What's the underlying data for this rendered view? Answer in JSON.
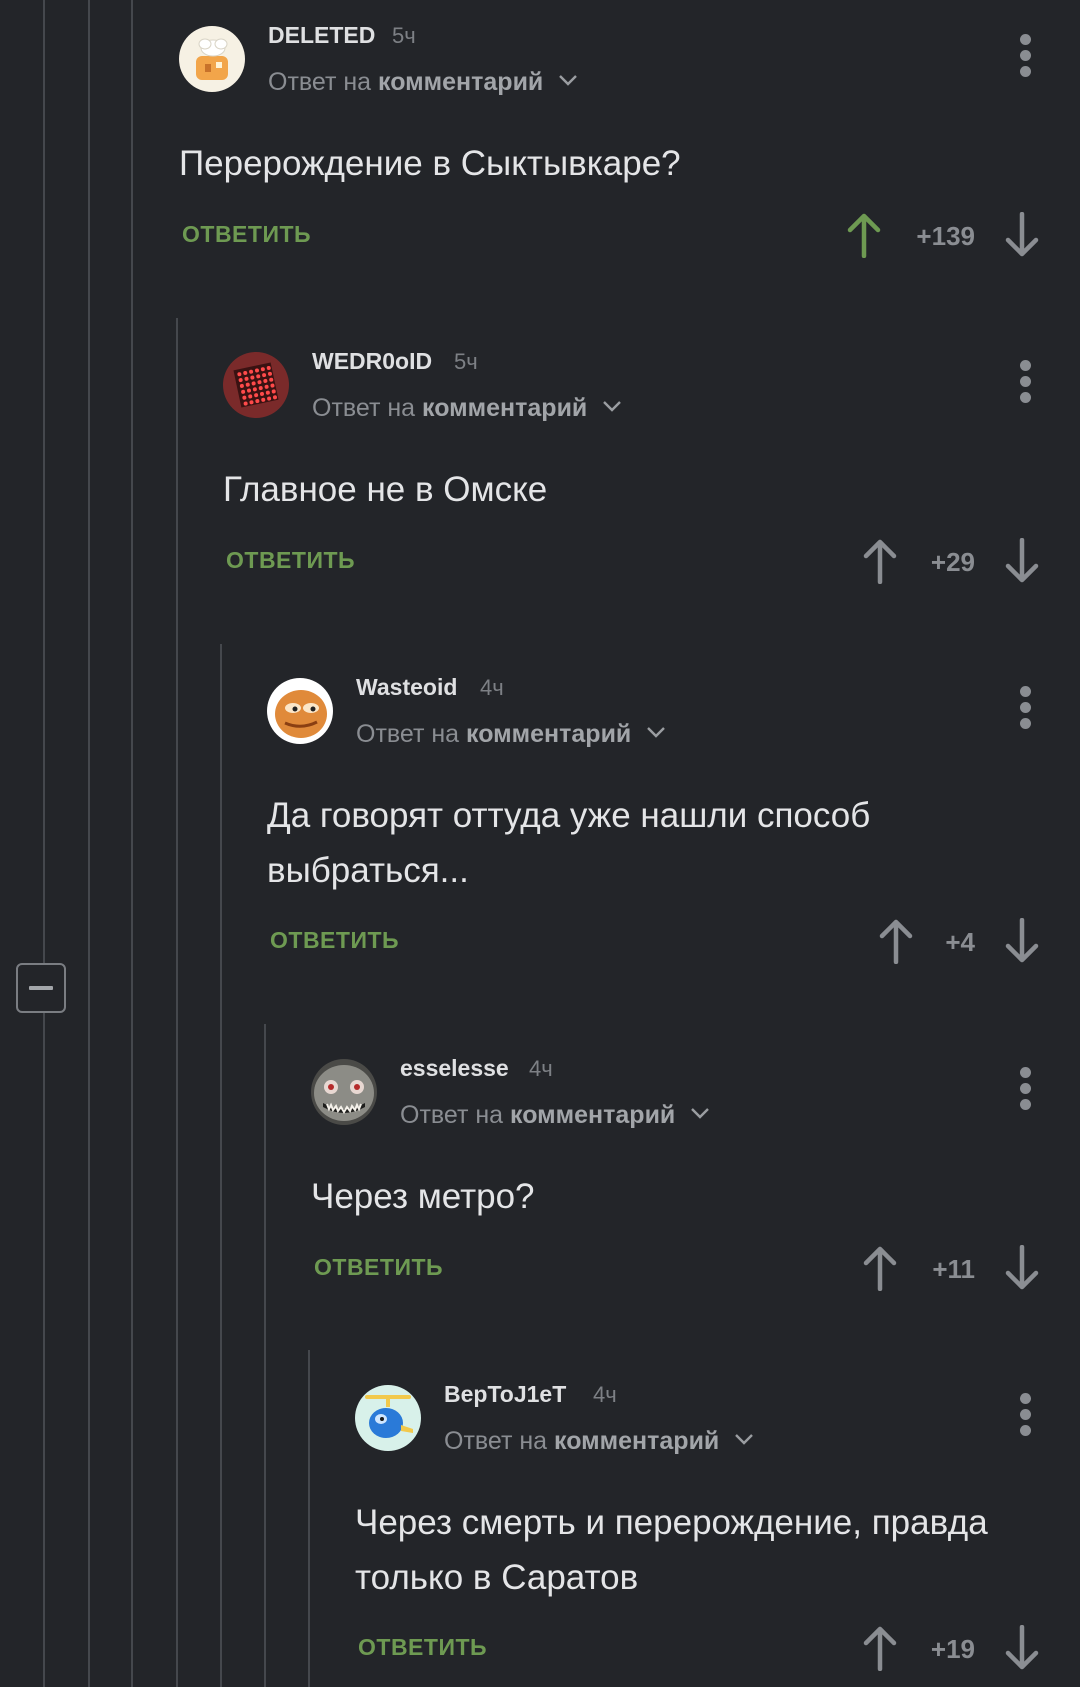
{
  "reply_to_prefix": "Ответ на",
  "reply_to_target": "комментарий",
  "reply_action_label": "ОТВЕТИТЬ",
  "colors": {
    "background": "#232529",
    "reply_green": "#6e9a52",
    "upvoted_arrow": "#6e9a52",
    "muted_gray": "#8a8d92"
  },
  "comments": [
    {
      "username": "DELETED",
      "time": "5ч",
      "text": "Перерождение в Сыктывкаре?",
      "score": "+139",
      "upvoted": true,
      "avatar": "chef-house-avatar"
    },
    {
      "username": "WEDR0oID",
      "time": "5ч",
      "text": "Главное не в Омске",
      "score": "+29",
      "upvoted": false,
      "avatar": "red-led-matrix-avatar"
    },
    {
      "username": "Wasteoid",
      "time": "4ч",
      "text": "Да говорят оттуда уже нашли способ выбраться...",
      "score": "+4",
      "upvoted": false,
      "avatar": "pepe-face-avatar"
    },
    {
      "username": "esselesse",
      "time": "4ч",
      "text": "Через метро?",
      "score": "+11",
      "upvoted": false,
      "avatar": "grinning-monster-avatar"
    },
    {
      "username": "BepToJ1eT",
      "time": "4ч",
      "text": "Через смерть и перерождение, правда только в Саратов",
      "score": "+19",
      "upvoted": false,
      "avatar": "blue-helicopter-avatar"
    }
  ]
}
